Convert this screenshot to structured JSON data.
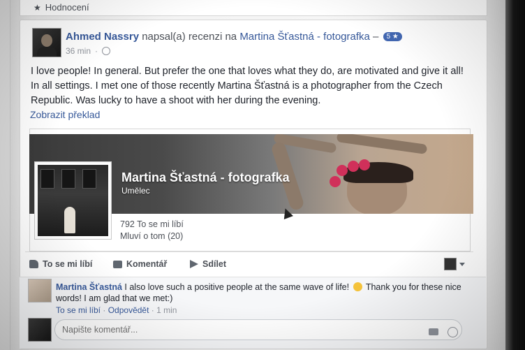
{
  "previous_section": {
    "label": "Hodnocení"
  },
  "post": {
    "author": "Ahmed Nassry",
    "action_text": "napsal(a) recenzi na",
    "page_link": "Martina Šťastná - fotografka",
    "separator": "–",
    "rating": "5 ★",
    "time": "36 min",
    "body": "I love people! In general. But prefer the one that loves what they do, are motivated and give it all! In all settings. I met one of those recently Martina Šťastná is a photographer from the Czech Republic. Was lucky to have a shoot with her during the evening.",
    "translate_label": "Zobrazit překlad"
  },
  "page_card": {
    "name": "Martina Šťastná - fotografka",
    "category": "Umělec",
    "likes": "792 To se mi líbí",
    "talking": "Mluví o tom (20)"
  },
  "actions": {
    "like": "To se mi líbí",
    "comment": "Komentář",
    "share": "Sdílet"
  },
  "comment": {
    "author": "Martina Šťastná",
    "text_part1": "I also love such a positive people at the same wave of life!",
    "text_part2": "Thank you for these nice words! I am glad that we met:)",
    "like_label": "To se mi líbí",
    "reply_label": "Odpovědět",
    "time": "1 min",
    "dot": "·"
  },
  "write_comment": {
    "placeholder": "Napište komentář..."
  },
  "colors": {
    "link": "#365899",
    "badge": "#4267b2",
    "text": "#1d2129",
    "muted": "#90949c"
  },
  "icons": [
    "star-icon",
    "globe-icon",
    "like-icon",
    "comment-icon",
    "share-icon",
    "camera-icon",
    "emoji-icon",
    "chevron-down-icon",
    "cursor-icon"
  ]
}
